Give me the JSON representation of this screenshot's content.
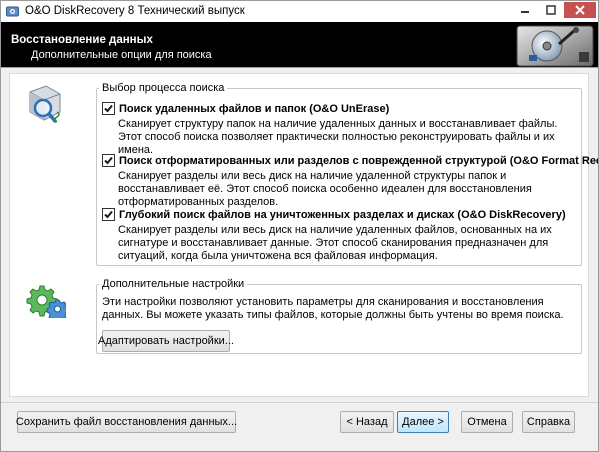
{
  "window": {
    "title": "O&O DiskRecovery 8 Технический выпуск"
  },
  "header": {
    "title": "Восстановление данных",
    "subtitle": "Дополнительные опции для поиска"
  },
  "search_group": {
    "legend": "Выбор процесса поиска",
    "options": [
      {
        "label": "Поиск удаленных файлов и папок (O&O UnErase)",
        "checked": true,
        "description": "Сканирует структуру папок на наличие удаленных данных и восстанавливает файлы. Этот способ поиска позволяет практически полностью реконструировать файлы и их имена."
      },
      {
        "label": "Поиск отформатированных или разделов с поврежденной структурой (O&O Format Recovery)",
        "checked": true,
        "description": "Сканирует разделы или весь диск на наличие удаленной структуры папок и восстанавливает её. Этот способ поиска особенно идеален для восстановления отформатированных разделов."
      },
      {
        "label": "Глубокий поиск файлов на уничтоженных разделах и дисках (O&O DiskRecovery)",
        "checked": true,
        "description": "Сканирует разделы или весь диск на наличие удаленных файлов, основанных на их сигнатуре и восстанавливает данные. Этот способ сканирования предназначен для ситуаций, когда была уничтожена вся файловая информация."
      }
    ]
  },
  "settings_group": {
    "legend": "Дополнительные настройки",
    "description": "Эти настройки позволяют установить параметры для сканирования и восстановления данных. Вы можете указать типы файлов, которые должны быть учтены во время поиска.",
    "adjust_button": "Адаптировать настройки..."
  },
  "footer": {
    "save_button": "Сохранить файл восстановления данных...",
    "back_button": "< Назад",
    "next_button": "Далее >",
    "cancel_button": "Отмена",
    "help_button": "Справка"
  },
  "colors": {
    "header_bg": "#000000",
    "close_button": "#c75050",
    "primary_button_border": "#3c7fb1",
    "checkmark": "#1a1a1a"
  },
  "icons": {
    "app": "disk-recovery-app-icon",
    "search_process": "disk-magnifier-icon",
    "settings": "gears-icon",
    "header_art": "disk-drive-art"
  }
}
